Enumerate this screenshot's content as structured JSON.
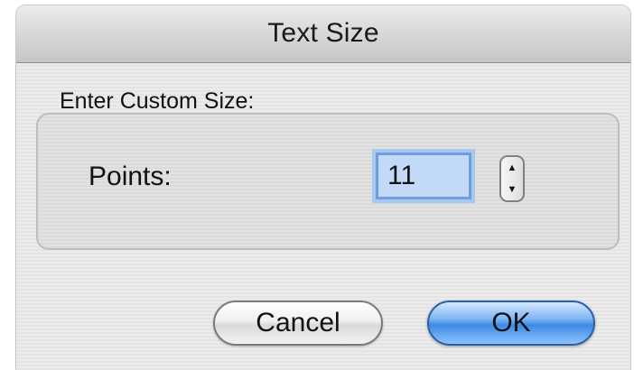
{
  "dialog": {
    "title": "Text Size",
    "group_label": "Enter Custom Size:",
    "points_label": "Points:",
    "points_value": "11",
    "cancel_label": "Cancel",
    "ok_label": "OK"
  },
  "icons": {
    "stepper_up": "arrow-up-icon",
    "stepper_down": "arrow-down-icon"
  },
  "colors": {
    "default_button": "#3d8ae6",
    "focus_ring": "#6e9ede",
    "input_highlight": "#c3d9f8"
  }
}
